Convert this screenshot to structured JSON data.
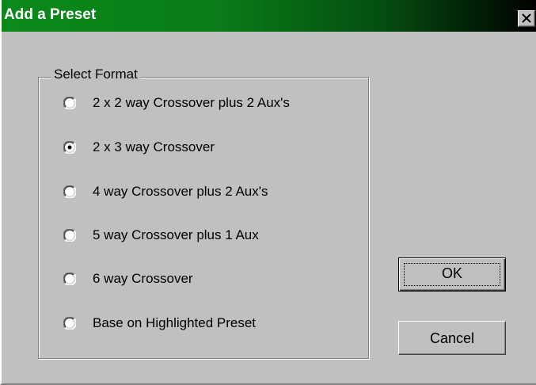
{
  "dialog": {
    "title": "Add a Preset",
    "close_label": "×"
  },
  "format_group": {
    "label": "Select Format",
    "options": [
      {
        "label": "2 x 2 way Crossover plus 2 Aux's",
        "selected": false
      },
      {
        "label": "2 x 3 way Crossover",
        "selected": true
      },
      {
        "label": "4 way Crossover  plus 2 Aux's",
        "selected": false
      },
      {
        "label": "5 way Crossover plus 1 Aux",
        "selected": false
      },
      {
        "label": "6 way Crossover",
        "selected": false
      },
      {
        "label": "Base on Highlighted Preset",
        "selected": false
      }
    ]
  },
  "buttons": {
    "ok_label": "OK",
    "cancel_label": "Cancel"
  },
  "colors": {
    "titlebar_start": "#0b8a1a",
    "titlebar_end": "#000000",
    "face": "#c0c0c0"
  }
}
